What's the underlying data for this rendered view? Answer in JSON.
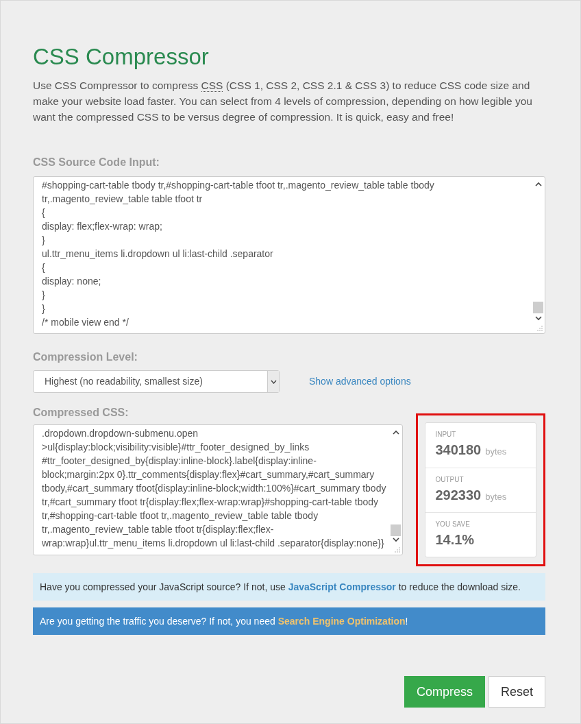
{
  "title": "CSS Compressor",
  "intro": [
    {
      "text": "Use CSS Compressor to compress ",
      "abbr": false
    },
    {
      "text": "CSS",
      "abbr": true
    },
    {
      "text": " (CSS 1, CSS 2, CSS 2.1 & CSS 3) to reduce CSS code size and make your website load faster. You can select from 4 levels of compression, depending on how legible you want the compressed CSS to be versus degree of compression. It is quick, easy and free!",
      "abbr": false
    }
  ],
  "source": {
    "label": "CSS Source Code Input:",
    "lines": [
      "#shopping-cart-table tbody tr,#shopping-cart-table tfoot tr,.magento_review_table table tbody",
      "tr,.magento_review_table table tfoot tr",
      "{",
      "display: flex;flex-wrap: wrap;",
      "}",
      "ul.ttr_menu_items li.dropdown ul li:last-child .separator",
      "{",
      "display: none;",
      "}",
      "}",
      "/* mobile view end */"
    ]
  },
  "compression": {
    "label": "Compression Level:",
    "value": "Highest (no readability, smallest size)",
    "advanced_link": "Show advanced options"
  },
  "output": {
    "label": "Compressed CSS:",
    "lines": [
      ".dropdown.dropdown-submenu.open",
      ">ul{display:block;visibility:visible}#ttr_footer_designed_by_links",
      "#ttr_footer_designed_by{display:inline-block}.label{display:inline-",
      "block;margin:2px 0}.ttr_comments{display:flex}#cart_summary,#cart_summary",
      "tbody,#cart_summary tfoot{display:inline-block;width:100%}#cart_summary tbody",
      "tr,#cart_summary tfoot tr{display:flex;flex-wrap:wrap}#shopping-cart-table tbody",
      "tr,#shopping-cart-table tfoot tr,.magento_review_table table tbody",
      "tr,.magento_review_table table tfoot tr{display:flex;flex-",
      "wrap:wrap}ul.ttr_menu_items li.dropdown ul li:last-child .separator{display:none}}"
    ]
  },
  "stats": {
    "highlighted": true,
    "items": [
      {
        "label": "INPUT",
        "value": "340180",
        "unit": "bytes"
      },
      {
        "label": "OUTPUT",
        "value": "292330",
        "unit": "bytes"
      },
      {
        "label": "YOU SAVE",
        "value": "14.1%"
      }
    ]
  },
  "notices": [
    {
      "kind": "info",
      "before": "Have you compressed your JavaScript source? If not, use ",
      "link": "JavaScript Compressor",
      "after": " to reduce the download size."
    },
    {
      "kind": "primary",
      "before": "Are you getting the traffic you deserve? If not, you need ",
      "link": "Search Engine Optimization",
      "after": "!"
    }
  ],
  "buttons": [
    {
      "kind": "primary",
      "label": "Compress"
    },
    {
      "kind": "default",
      "label": "Reset"
    }
  ]
}
